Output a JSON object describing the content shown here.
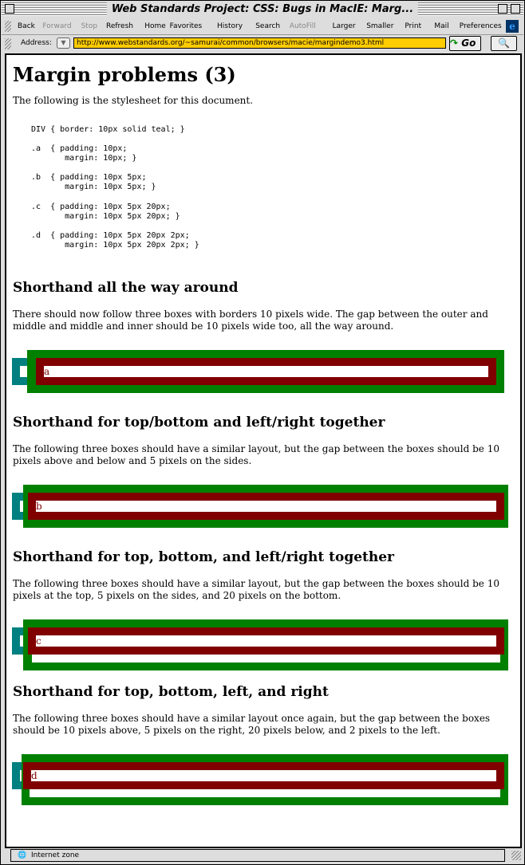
{
  "window": {
    "title": "Web Standards Project: CSS: Bugs in MacIE: Marg..."
  },
  "toolbar": {
    "buttons": [
      {
        "label": "Back",
        "enabled": true
      },
      {
        "label": "Forward",
        "enabled": false
      },
      {
        "label": "Stop",
        "enabled": false
      },
      {
        "label": "Refresh",
        "enabled": true
      },
      {
        "label": "Home",
        "enabled": true
      },
      {
        "label": "Favorites",
        "enabled": true
      },
      {
        "label": "History",
        "enabled": true
      },
      {
        "label": "Search",
        "enabled": true
      },
      {
        "label": "AutoFill",
        "enabled": false
      },
      {
        "label": "Larger",
        "enabled": true
      },
      {
        "label": "Smaller",
        "enabled": true
      },
      {
        "label": "Print",
        "enabled": true
      },
      {
        "label": "Mail",
        "enabled": true
      },
      {
        "label": "Preferences",
        "enabled": true
      }
    ]
  },
  "address": {
    "label": "Address:",
    "url": "http://www.webstandards.org/~samurai/common/browsers/macie/margindemo3.html",
    "go_label": "Go"
  },
  "page": {
    "title": "Margin problems (3)",
    "intro": "The following is the stylesheet for this document.",
    "code": [
      "DIV { border: 10px solid teal; }",
      ".a  { padding: 10px;\n       margin: 10px; }",
      ".b  { padding: 10px 5px;\n       margin: 10px 5px; }",
      ".c  { padding: 10px 5px 20px;\n       margin: 10px 5px 20px; }",
      ".d  { padding: 10px 5px 20px 2px;\n       margin: 10px 5px 20px 2px; }"
    ],
    "sections": [
      {
        "heading": "Shorthand all the way around",
        "text": "There should now follow three boxes with borders 10 pixels wide. The gap between the outer and middle and middle and inner should be 10 pixels wide too, all the way around.",
        "label": "a"
      },
      {
        "heading": "Shorthand for top/bottom and left/right together",
        "text": "The following three boxes should have a similar layout, but the gap between the boxes should be 10 pixels above and below and 5 pixels on the sides.",
        "label": "b"
      },
      {
        "heading": "Shorthand for top, bottom, and left/right together",
        "text": "The following three boxes should have a similar layout, but the gap between the boxes should be 10 pixels at the top, 5 pixels on the sides, and 20 pixels on the bottom.",
        "label": "c"
      },
      {
        "heading": "Shorthand for top, bottom, left, and right",
        "text": "The following three boxes should have a similar layout once again, but the gap between the boxes should be 10 pixels above, 5 pixels on the right, 20 pixels below, and 2 pixels to the left.",
        "label": "d"
      }
    ]
  },
  "colors": {
    "outer": "#008080",
    "middle": "#008000",
    "inner": "#800000",
    "url_bg": "#ffcc00"
  },
  "status": {
    "text": "Internet zone"
  }
}
